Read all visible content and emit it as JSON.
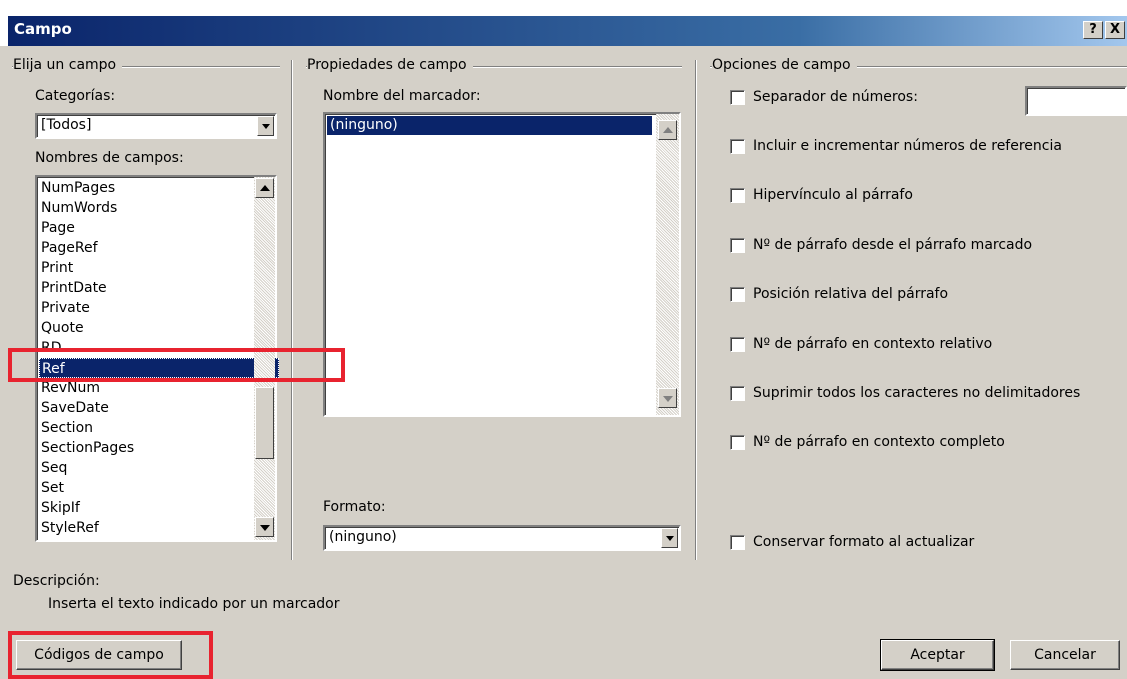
{
  "window": {
    "title": "Campo",
    "help_btn": "?",
    "close_btn": "X"
  },
  "left": {
    "group": "Elija un campo",
    "categories_label": "Categorías:",
    "categories_value": "[Todos]",
    "field_names_label": "Nombres de campos:",
    "items": [
      "NumPages",
      "NumWords",
      "Page",
      "PageRef",
      "Print",
      "PrintDate",
      "Private",
      "Quote",
      "RD",
      "Ref",
      "RevNum",
      "SaveDate",
      "Section",
      "SectionPages",
      "Seq",
      "Set",
      "SkipIf",
      "StyleRef"
    ],
    "selected": "Ref"
  },
  "middle": {
    "group": "Propiedades de campo",
    "bookmark_label": "Nombre del marcador:",
    "bookmark_items": [
      "(ninguno)"
    ],
    "format_label": "Formato:",
    "format_value": "(ninguno)"
  },
  "right": {
    "group": "Opciones de campo",
    "options": [
      "Separador de números:",
      "Incluir e incrementar números de referencia",
      "Hipervínculo al párrafo",
      "Nº de párrafo desde el párrafo marcado",
      "Posición relativa del párrafo",
      "Nº de párrafo en contexto relativo",
      "Suprimir todos los caracteres no delimitadores",
      "Nº de párrafo en contexto completo"
    ],
    "preserve_format": "Conservar formato al actualizar"
  },
  "description": {
    "label": "Descripción:",
    "text": "Inserta el texto indicado por un marcador"
  },
  "buttons": {
    "field_codes": "Códigos de campo",
    "ok": "Aceptar",
    "cancel": "Cancelar"
  },
  "colors": {
    "selection": "#0a246a",
    "highlight_box": "#e8232f",
    "face": "#d4d0c8"
  }
}
